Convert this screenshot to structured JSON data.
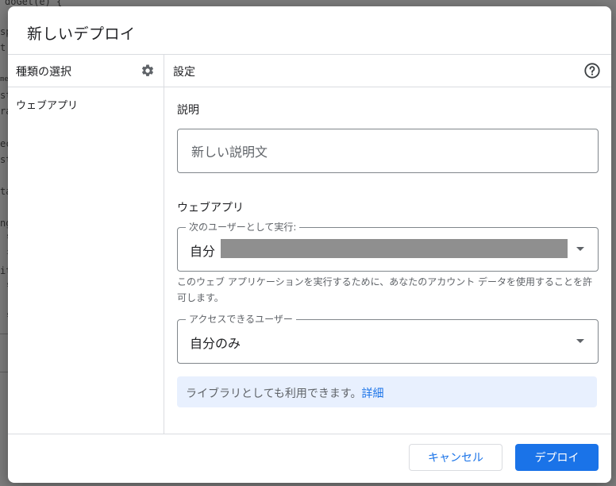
{
  "background": {
    "code_lines": [
      "doGet(e) {",
      "sp",
      "t",
      "me",
      "st",
      "ra",
      "ec",
      "st",
      "ta",
      "ng",
      "s",
      "i",
      "it",
      "s",
      "s"
    ]
  },
  "dialog": {
    "title": "新しいデプロイ",
    "left_panel": {
      "heading": "種類の選択",
      "settings_icon": "gear-icon",
      "items": [
        {
          "label": "ウェブアプリ"
        }
      ]
    },
    "right_panel": {
      "heading": "設定",
      "help_icon": "help-circle-icon",
      "description": {
        "label": "説明",
        "placeholder": "新しい説明文",
        "value": ""
      },
      "webapp": {
        "section_label": "ウェブアプリ",
        "execute_as": {
          "legend": "次のユーザーとして実行:",
          "value": "自分"
        },
        "help_text": "このウェブ アプリケーションを実行するために、あなたのアカウント データを使用することを許可します。",
        "access": {
          "legend": "アクセスできるユーザー",
          "value": "自分のみ"
        }
      },
      "info": {
        "text": "ライブラリとしても利用できます。",
        "link": "詳細"
      }
    },
    "footer": {
      "cancel_label": "キャンセル",
      "deploy_label": "デプロイ"
    },
    "colors": {
      "accent": "#1a73e8",
      "info_bg": "#e8f0fe",
      "border": "#dadce0"
    }
  }
}
